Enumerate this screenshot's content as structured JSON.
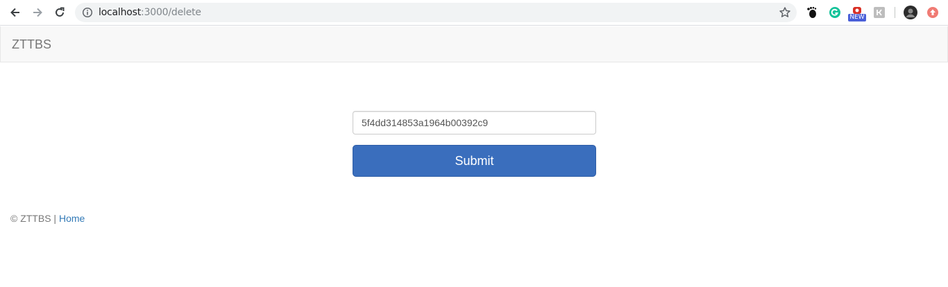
{
  "browser": {
    "url_host": "localhost",
    "url_path": ":3000/delete",
    "extension_badge": "NEW",
    "icons": [
      "back-icon",
      "forward-icon",
      "reload-icon",
      "info-icon",
      "star-icon",
      "gnome-foot-icon",
      "grammarly-icon",
      "new-extension-icon",
      "extension-icon",
      "profile-avatar-icon",
      "extension-red-icon"
    ]
  },
  "navbar": {
    "brand": "ZTTBS"
  },
  "form": {
    "id_value": "5f4dd314853a1964b00392c9",
    "submit_label": "Submit"
  },
  "footer": {
    "copyright": "© ZTTBS |",
    "home_link": "Home"
  },
  "colors": {
    "submit_bg": "#3a6ebd",
    "link": "#337ab7",
    "navbar_bg": "#f8f8f8"
  }
}
